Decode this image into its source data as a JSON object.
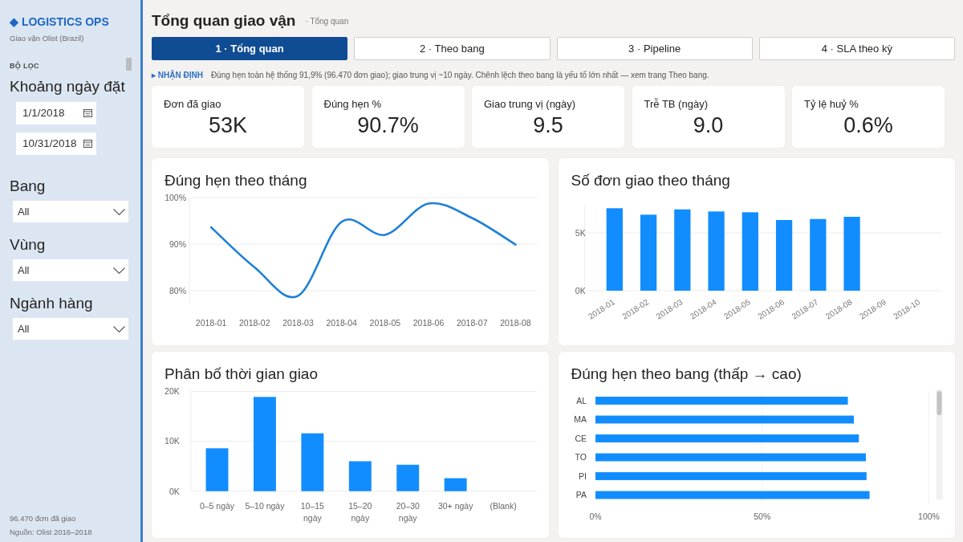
{
  "sidebar": {
    "logo": "◆ LOGISTICS OPS",
    "subtitle": "Giao vận Olist (Brazil)",
    "section_label": "BỘ LỌC",
    "filters": [
      {
        "kind": "date_range",
        "label": "Khoảng ngày đặt",
        "values": [
          "1/1/2018",
          "10/31/2018"
        ]
      },
      {
        "kind": "dropdown",
        "label": "Bang",
        "value": "All"
      },
      {
        "kind": "dropdown",
        "label": "Vùng",
        "value": "All"
      },
      {
        "kind": "dropdown",
        "label": "Ngành hàng",
        "value": "All"
      }
    ],
    "footer": [
      "96.470 đơn đã giao",
      "Nguồn: Olist 2016–2018"
    ]
  },
  "header": {
    "title": "Tổng quan giao vận",
    "breadcrumb": "· Tổng quan"
  },
  "tabs": [
    {
      "label": "1 · Tổng quan",
      "selected": true
    },
    {
      "label": "2 · Theo bang",
      "selected": false
    },
    {
      "label": "3 · Pipeline",
      "selected": false
    },
    {
      "label": "4 · SLA theo kỳ",
      "selected": false
    }
  ],
  "insight": {
    "label": "▸ NHẬN ĐỊNH",
    "text": "Đúng hẹn toàn hệ thống 91,9% (96.470 đơn giao); giao trung vị ~10 ngày. Chênh lệch theo bang là yếu tố lớn nhất — xem trang Theo bang."
  },
  "kpis": [
    {
      "label": "Đơn đã giao",
      "value": "53K"
    },
    {
      "label": "Đúng hẹn %",
      "value": "90.7%"
    },
    {
      "label": "Giao trung vị (ngày)",
      "value": "9.5"
    },
    {
      "label": "Trễ TB (ngày)",
      "value": "9.0"
    },
    {
      "label": "Tỷ lệ huỷ %",
      "value": "0.6%"
    }
  ],
  "charts": [
    {
      "chart_data": {
        "type": "line",
        "title": "Đúng hẹn theo tháng",
        "categories": [
          "2018-01",
          "2018-02",
          "2018-03",
          "2018-04",
          "2018-05",
          "2018-06",
          "2018-07",
          "2018-08"
        ],
        "values": [
          93.6,
          85.0,
          78.9,
          94.8,
          92.0,
          98.7,
          95.6,
          89.9
        ],
        "ylim": [
          77,
          100
        ],
        "yticks": [
          {
            "value": 80,
            "label": "80%"
          },
          {
            "value": 90,
            "label": "90%"
          },
          {
            "value": 100,
            "label": "100%"
          }
        ]
      }
    },
    {
      "chart_data": {
        "type": "bar",
        "title": "Số đơn giao theo tháng",
        "categories": [
          "2018-01",
          "2018-02",
          "2018-03",
          "2018-04",
          "2018-05",
          "2018-06",
          "2018-07",
          "2018-08",
          "2018-09",
          "2018-10"
        ],
        "values": [
          7130,
          6570,
          7030,
          6850,
          6780,
          6110,
          6200,
          6390,
          null,
          null
        ],
        "ylim": [
          0,
          7500
        ],
        "yticks": [
          {
            "value": 0,
            "label": "0K"
          },
          {
            "value": 5000,
            "label": "5K"
          }
        ]
      }
    },
    {
      "chart_data": {
        "type": "bar",
        "title": "Phân bố thời gian giao",
        "categories": [
          "0–5 ngày",
          "5–10 ngày",
          "10–15 ngày",
          "15–20 ngày",
          "20–30 ngày",
          "30+ ngày",
          "(Blank)"
        ],
        "values": [
          8600,
          18900,
          11600,
          6000,
          5300,
          2600,
          null
        ],
        "ylim": [
          0,
          20000
        ],
        "yticks": [
          {
            "value": 0,
            "label": "0K"
          },
          {
            "value": 10000,
            "label": "10K"
          },
          {
            "value": 20000,
            "label": "20K"
          }
        ]
      }
    },
    {
      "chart_data": {
        "type": "bar",
        "orientation": "horizontal",
        "title": "Đúng hẹn theo bang (thấp → cao)",
        "categories": [
          "AL",
          "MA",
          "CE",
          "TO",
          "PI",
          "PA"
        ],
        "values": [
          75.7,
          77.5,
          79.0,
          81.1,
          81.3,
          82.2
        ],
        "xlim": [
          0,
          100
        ],
        "xticks": [
          {
            "value": 0,
            "label": "0%"
          },
          {
            "value": 50,
            "label": "50%"
          },
          {
            "value": 100,
            "label": "100%"
          }
        ]
      }
    }
  ]
}
